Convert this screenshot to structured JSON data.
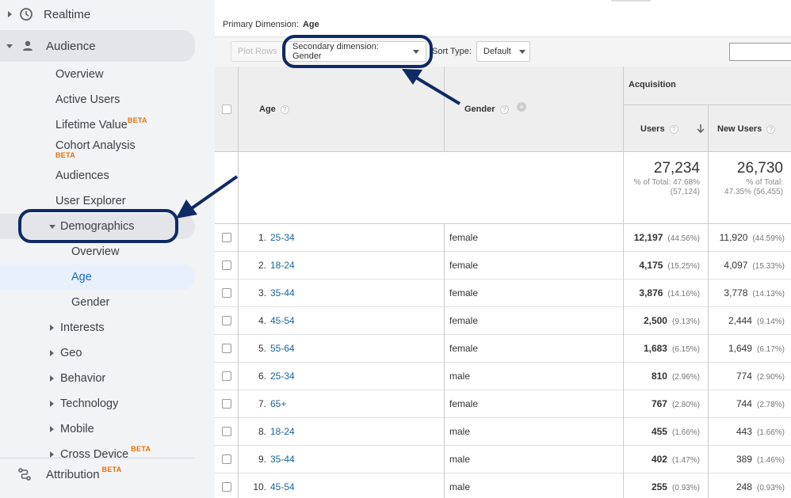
{
  "sidebar": {
    "realtime": "Realtime",
    "audience": "Audience",
    "overview": "Overview",
    "active_users": "Active Users",
    "lifetime_value": "Lifetime Value",
    "cohort_analysis": "Cohort Analysis",
    "audiences": "Audiences",
    "user_explorer": "User Explorer",
    "demographics": "Demographics",
    "demo_overview": "Overview",
    "demo_age": "Age",
    "demo_gender": "Gender",
    "interests": "Interests",
    "geo": "Geo",
    "behavior": "Behavior",
    "technology": "Technology",
    "mobile": "Mobile",
    "cross_device": "Cross Device",
    "attribution": "Attribution",
    "beta": "BETA"
  },
  "toolbar": {
    "primary_dim_label": "Primary Dimension:",
    "primary_dim_value": "Age",
    "plot_rows": "Plot Rows",
    "secondary_dim": "Secondary dimension: Gender",
    "sort_type_label": "Sort Type:",
    "sort_type_value": "Default"
  },
  "table": {
    "col_age": "Age",
    "col_gender": "Gender",
    "group_acquisition": "Acquisition",
    "col_users": "Users",
    "col_new_users": "New Users",
    "totals": {
      "users": "27,234",
      "users_sub1": "% of Total: 47.68%",
      "users_sub2": "(57,124)",
      "new_users": "26,730",
      "new_users_sub1": "% of Total:",
      "new_users_sub2": "47.35% (56,455)"
    },
    "rows": [
      {
        "idx": "1.",
        "age": "25-34",
        "gender": "female",
        "users": "12,197",
        "users_pct": "(44.56%)",
        "new_users": "11,920",
        "new_users_pct": "(44.59%)"
      },
      {
        "idx": "2.",
        "age": "18-24",
        "gender": "female",
        "users": "4,175",
        "users_pct": "(15.25%)",
        "new_users": "4,097",
        "new_users_pct": "(15.33%)"
      },
      {
        "idx": "3.",
        "age": "35-44",
        "gender": "female",
        "users": "3,876",
        "users_pct": "(14.16%)",
        "new_users": "3,778",
        "new_users_pct": "(14.13%)"
      },
      {
        "idx": "4.",
        "age": "45-54",
        "gender": "female",
        "users": "2,500",
        "users_pct": "(9.13%)",
        "new_users": "2,444",
        "new_users_pct": "(9.14%)"
      },
      {
        "idx": "5.",
        "age": "55-64",
        "gender": "female",
        "users": "1,683",
        "users_pct": "(6.15%)",
        "new_users": "1,649",
        "new_users_pct": "(6.17%)"
      },
      {
        "idx": "6.",
        "age": "25-34",
        "gender": "male",
        "users": "810",
        "users_pct": "(2.96%)",
        "new_users": "774",
        "new_users_pct": "(2.90%)"
      },
      {
        "idx": "7.",
        "age": "65+",
        "gender": "female",
        "users": "767",
        "users_pct": "(2.80%)",
        "new_users": "744",
        "new_users_pct": "(2.78%)"
      },
      {
        "idx": "8.",
        "age": "18-24",
        "gender": "male",
        "users": "455",
        "users_pct": "(1.66%)",
        "new_users": "443",
        "new_users_pct": "(1.66%)"
      },
      {
        "idx": "9.",
        "age": "35-44",
        "gender": "male",
        "users": "402",
        "users_pct": "(1.47%)",
        "new_users": "389",
        "new_users_pct": "(1.46%)"
      },
      {
        "idx": "10.",
        "age": "45-54",
        "gender": "male",
        "users": "255",
        "users_pct": "(0.93%)",
        "new_users": "248",
        "new_users_pct": "(0.93%)"
      }
    ]
  },
  "colors": {
    "link": "#1a6599",
    "annotation": "#0f2a64",
    "beta": "#e8710a",
    "selected": "#e8f0fe"
  },
  "icons": {
    "realtime": "clock-icon",
    "audience": "person-icon",
    "attribution": "attribution-icon",
    "sort": "sort-down-arrow-icon",
    "remove": "close-circle-icon",
    "help": "help-icon"
  }
}
